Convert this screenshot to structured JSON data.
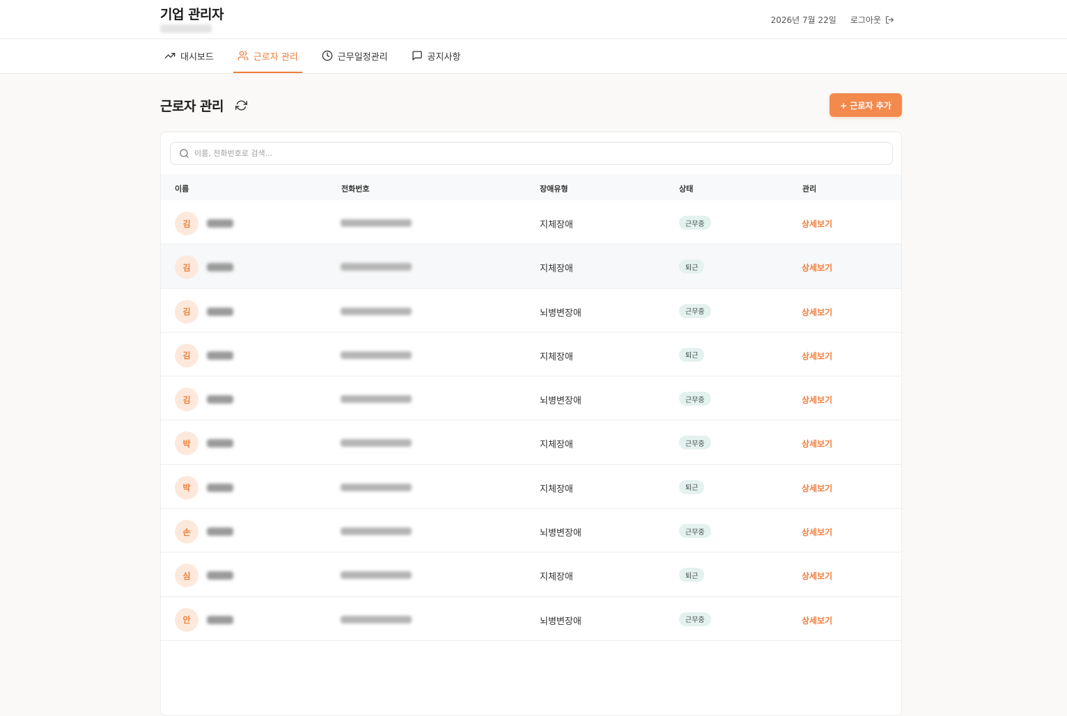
{
  "header": {
    "title": "기업 관리자",
    "date": "2026년 7월 22일",
    "logout_label": "로그아웃"
  },
  "nav": {
    "tabs": [
      {
        "label": "대시보드",
        "icon": "trending-up-icon",
        "active": false
      },
      {
        "label": "근로자 관리",
        "icon": "users-icon",
        "active": true
      },
      {
        "label": "근무일정관리",
        "icon": "clock-icon",
        "active": false
      },
      {
        "label": "공지사항",
        "icon": "message-square-icon",
        "active": false
      }
    ]
  },
  "page": {
    "title": "근로자 관리",
    "add_button_label": "+ 근로자 추가"
  },
  "search": {
    "placeholder": "이름, 전화번호로 검색..."
  },
  "table": {
    "columns": [
      "이름",
      "전화번호",
      "장애유형",
      "상태",
      "관리"
    ],
    "rows": [
      {
        "initial": "김",
        "type": "지체장애",
        "status": "근무중",
        "action": "상세보기"
      },
      {
        "initial": "김",
        "type": "지체장애",
        "status": "퇴근",
        "action": "상세보기"
      },
      {
        "initial": "김",
        "type": "뇌병변장애",
        "status": "근무중",
        "action": "상세보기"
      },
      {
        "initial": "김",
        "type": "지체장애",
        "status": "퇴근",
        "action": "상세보기"
      },
      {
        "initial": "김",
        "type": "뇌병변장애",
        "status": "근무중",
        "action": "상세보기"
      },
      {
        "initial": "박",
        "type": "지체장애",
        "status": "근무중",
        "action": "상세보기"
      },
      {
        "initial": "박",
        "type": "지체장애",
        "status": "퇴근",
        "action": "상세보기"
      },
      {
        "initial": "손",
        "type": "뇌병변장애",
        "status": "근무중",
        "action": "상세보기"
      },
      {
        "initial": "심",
        "type": "지체장애",
        "status": "퇴근",
        "action": "상세보기"
      },
      {
        "initial": "안",
        "type": "뇌병변장애",
        "status": "근무중",
        "action": "상세보기"
      }
    ]
  },
  "colors": {
    "accent": "#ef7d3a",
    "avatar_bg": "#fde9dc",
    "badge_bg": "#e3f1ef"
  }
}
